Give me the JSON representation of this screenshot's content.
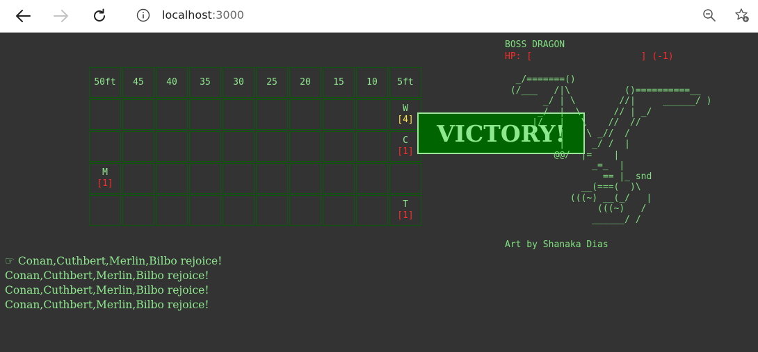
{
  "browser": {
    "url_host": "localhost",
    "url_port": ":3000",
    "icons": [
      "back-arrow-icon",
      "forward-arrow-icon",
      "refresh-icon",
      "info-icon",
      "zoom-out-icon",
      "favorite-star-icon"
    ]
  },
  "grid": {
    "header": [
      "50ft",
      "45",
      "40",
      "35",
      "30",
      "25",
      "20",
      "15",
      "10",
      "5ft"
    ],
    "rows": [
      [
        null,
        null,
        null,
        null,
        null,
        null,
        null,
        null,
        null,
        {
          "name": "W",
          "hp": "[4]",
          "hp_color": "yellow"
        }
      ],
      [
        null,
        null,
        null,
        null,
        null,
        null,
        null,
        null,
        null,
        {
          "name": "C",
          "hp": "[1]",
          "hp_color": "red"
        }
      ],
      [
        {
          "name": "M",
          "hp": "[1]",
          "hp_color": "red"
        },
        null,
        null,
        null,
        null,
        null,
        null,
        null,
        null,
        null
      ],
      [
        null,
        null,
        null,
        null,
        null,
        null,
        null,
        null,
        null,
        {
          "name": "T",
          "hp": "[1]",
          "hp_color": "red"
        }
      ]
    ]
  },
  "victory_text": "VICTORY!",
  "boss": {
    "name": "BOSS DRAGON",
    "hp_line": "HP: [                    ] (-1)",
    "art": "  _/=======()\n (/___   /|\\          ()==========__\n       _/ | \\        //|     ______/ )\n      _/  |  \\      // | _/\n     |/   |   \\    //  //\n     (    |    \\ _//  /\n          |     _/ /  |\n         @@/  |=    |\n                _=_  |\n                  == |_ snd\n              __(===(  )\\\n            (((~) __(_/   |\n                 (((~)   /\n                ______/ /",
    "credit": "Art by Shanaka Dias"
  },
  "log": [
    "☞ Conan,Cuthbert,Merlin,Bilbo rejoice!",
    "Conan,Cuthbert,Merlin,Bilbo rejoice!",
    "Conan,Cuthbert,Merlin,Bilbo rejoice!",
    "Conan,Cuthbert,Merlin,Bilbo rejoice!"
  ]
}
